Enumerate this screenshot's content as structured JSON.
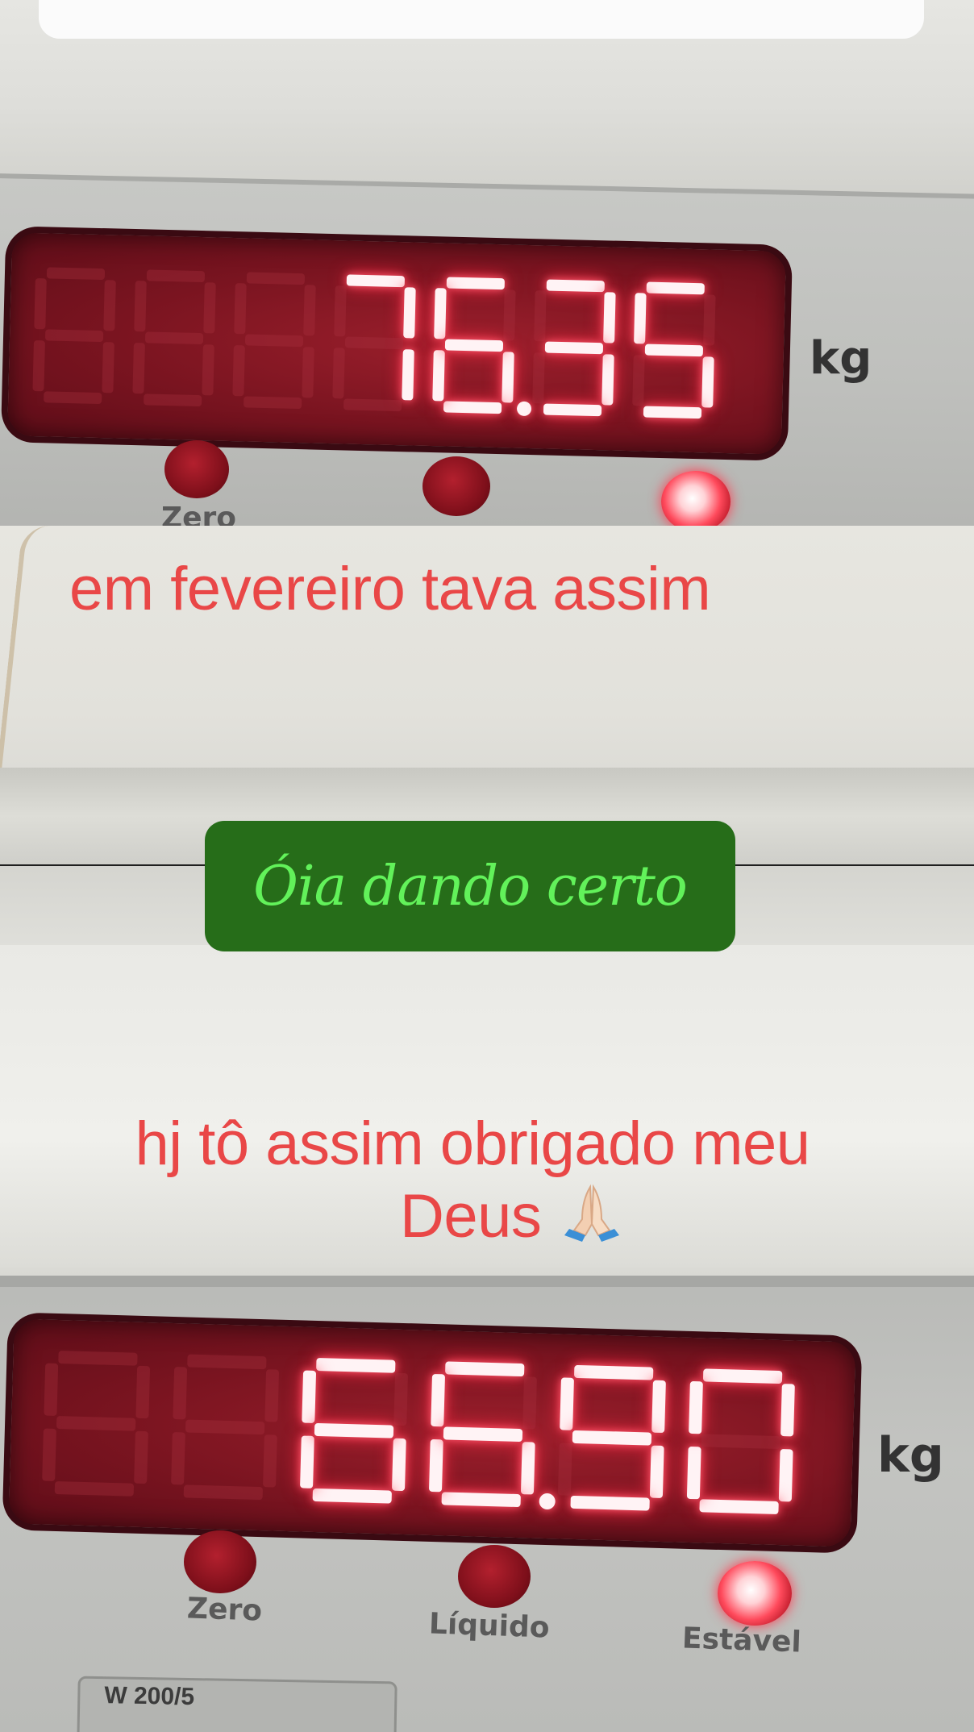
{
  "top_display": {
    "digits": [
      "",
      "",
      "",
      "7",
      "6",
      "3",
      "5"
    ],
    "reading": "76.35",
    "unit": "kg",
    "labels": [
      "Zero"
    ]
  },
  "caption_feb": "em fevereiro tava assim",
  "badge": {
    "text": "Óia dando certo",
    "bg": "#266d19",
    "fg": "#62f25a"
  },
  "caption_now": {
    "line1": "hj tô assim obrigado meu",
    "line2": "Deus",
    "icon": "praying-hands-icon"
  },
  "bottom_display": {
    "digits": [
      "",
      "",
      "6",
      "6",
      "9",
      "0"
    ],
    "reading": "66.90",
    "unit": "kg",
    "labels": [
      "Zero",
      "Líquido",
      "Estável"
    ],
    "model": "W 200/5"
  },
  "colors": {
    "caption": "#e94747",
    "led": "#ff2a44"
  }
}
